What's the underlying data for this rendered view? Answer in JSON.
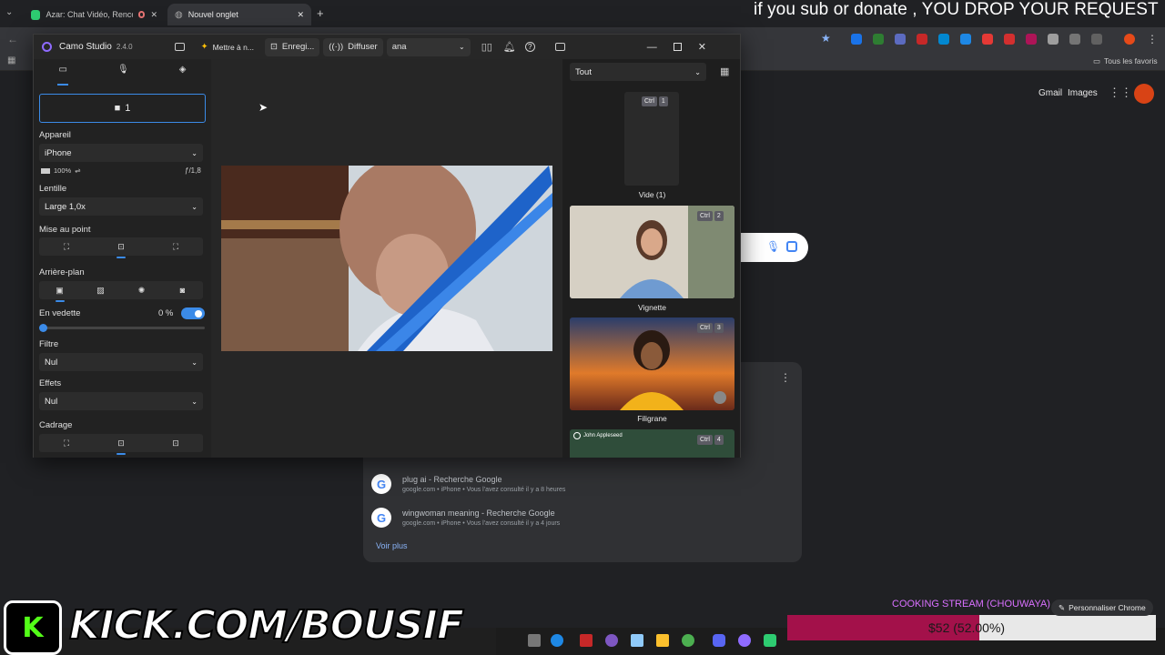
{
  "browser": {
    "tabs": [
      {
        "title": "Azar: Chat Vidéo, Rencontr",
        "active": false
      },
      {
        "title": "Nouvel onglet",
        "active": true
      }
    ],
    "bookmarks_label": "Tous les favoris"
  },
  "overlay": {
    "top_text": "if you sub or donate , YOU DROP YOUR REQUEST",
    "kick_text": "KICK.COM/BOUSIF",
    "goal_title": "COOKING STREAM (CHOUWAYA)",
    "goal_amount": "$52 (52.00%)",
    "goal_percent": 52
  },
  "google": {
    "nav": {
      "gmail": "Gmail",
      "images": "Images"
    },
    "history": [
      {
        "title": "plug ai - Recherche Google",
        "subtitle": "google.com • iPhone • Vous l'avez consulté il y a 8 heures"
      },
      {
        "title": "wingwoman meaning - Recherche Google",
        "subtitle": "google.com • iPhone • Vous l'avez consulté il y a 4 jours"
      }
    ],
    "see_more": "Voir plus",
    "customize": "Personnaliser Chrome"
  },
  "camo": {
    "title": "Camo Studio",
    "version": "2.4.0",
    "toolbar": {
      "update": "Mettre à n...",
      "record": "Enregi...",
      "broadcast": "Diffuser",
      "profile": "ana"
    },
    "source_button": "1",
    "device_label": "Appareil",
    "device_value": "iPhone",
    "battery": "100%",
    "aperture": "ƒ/1,8",
    "lens_label": "Lentille",
    "lens_value": "Large 1,0x",
    "focus_label": "Mise au point",
    "background_label": "Arrière-plan",
    "spotlight_label": "En vedette",
    "spotlight_value": "0 %",
    "filter_label": "Filtre",
    "filter_value": "Nul",
    "effects_label": "Effets",
    "effects_value": "Nul",
    "framing_label": "Cadrage",
    "scenes_filter": "Tout",
    "scenes": [
      {
        "name": "Vide (1)",
        "key": "1"
      },
      {
        "name": "Vignette",
        "key": "2"
      },
      {
        "name": "Filigrane",
        "key": "3"
      },
      {
        "name": "",
        "key": "4",
        "overlay_name": "John Appleseed"
      }
    ],
    "ctrl_key": "Ctrl"
  },
  "colors": {
    "accent": "#3b8be8",
    "goal_bar": "#a3114a",
    "goal_title": "#d970ff"
  }
}
